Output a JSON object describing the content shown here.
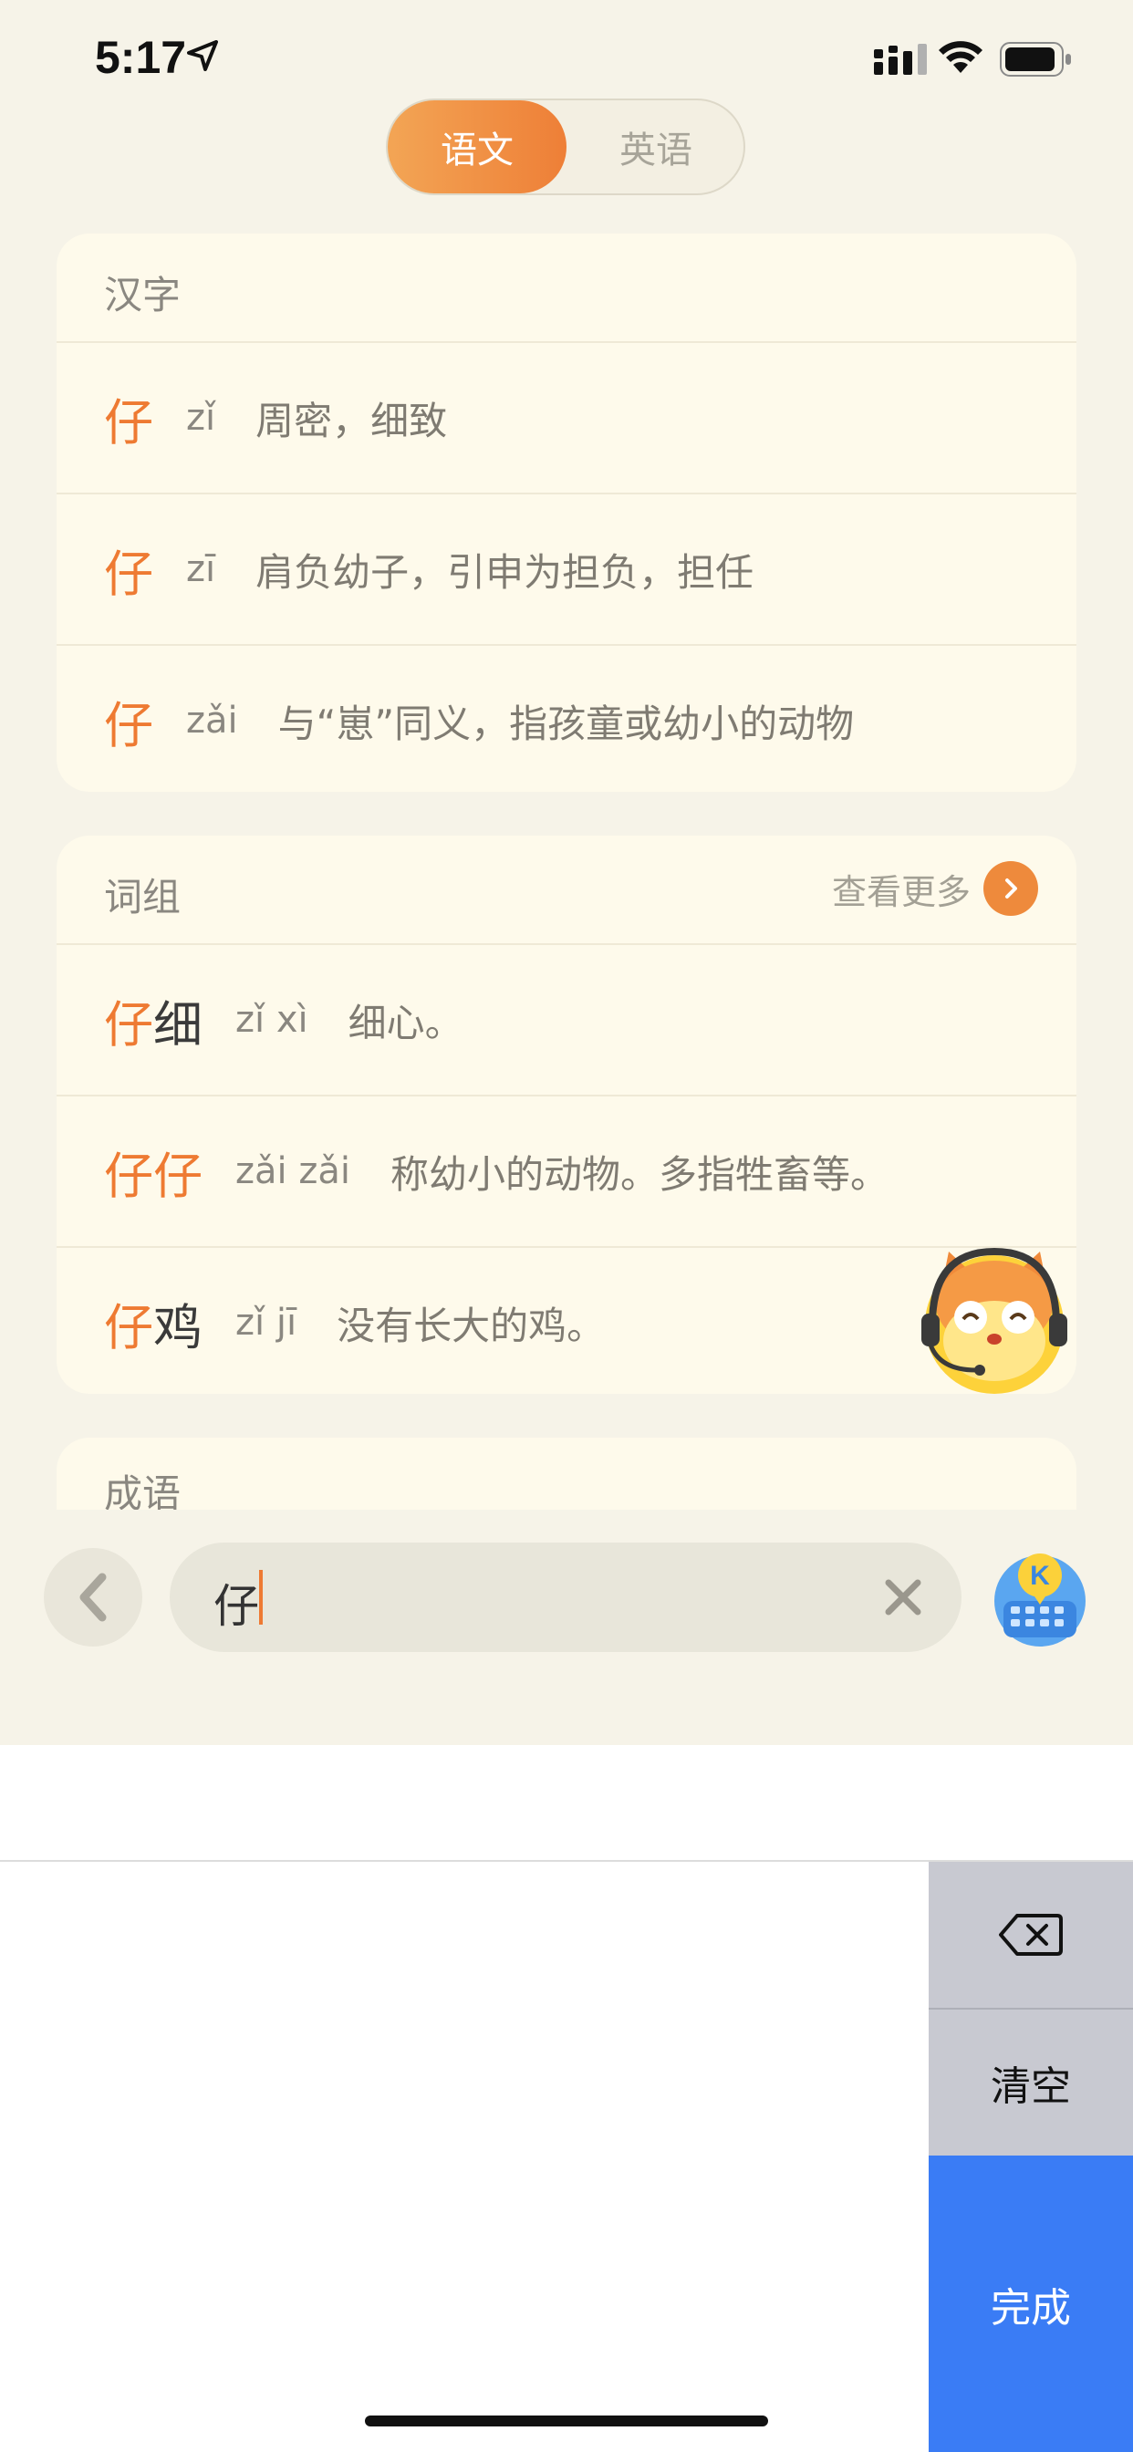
{
  "status": {
    "time": "5:17"
  },
  "tabs": [
    {
      "label": "语文",
      "active": true
    },
    {
      "label": "英语",
      "active": false
    }
  ],
  "hanzi": {
    "title": "汉字",
    "items": [
      {
        "char": "仔",
        "pinyin": "zǐ",
        "def": "周密，细致"
      },
      {
        "char": "仔",
        "pinyin": "zī",
        "def": "肩负幼子，引申为担负，担任"
      },
      {
        "char": "仔",
        "pinyin": "zǎi",
        "def": "与“崽”同义，指孩童或幼小的动物"
      }
    ]
  },
  "phrases": {
    "title": "词组",
    "more_label": "查看更多",
    "items": [
      {
        "hl": "仔",
        "rest": "细",
        "pinyin": "zǐ xì",
        "def": "细心。"
      },
      {
        "hl": "仔仔",
        "rest": "",
        "pinyin": "zǎi zǎi",
        "def": "称幼小的动物。多指牲畜等。"
      },
      {
        "hl": "仔",
        "rest": "鸡",
        "pinyin": "zǐ jī",
        "def": "没有长大的鸡。"
      }
    ]
  },
  "idioms": {
    "title": "成语"
  },
  "search": {
    "value": "仔"
  },
  "keyboard": {
    "clear_label": "清空",
    "done_label": "完成",
    "badge_letter": "K"
  },
  "colors": {
    "accent": "#ee7a32",
    "done_blue": "#3a7cf5",
    "background": "#f6f3e8",
    "card": "#fefaeb"
  }
}
